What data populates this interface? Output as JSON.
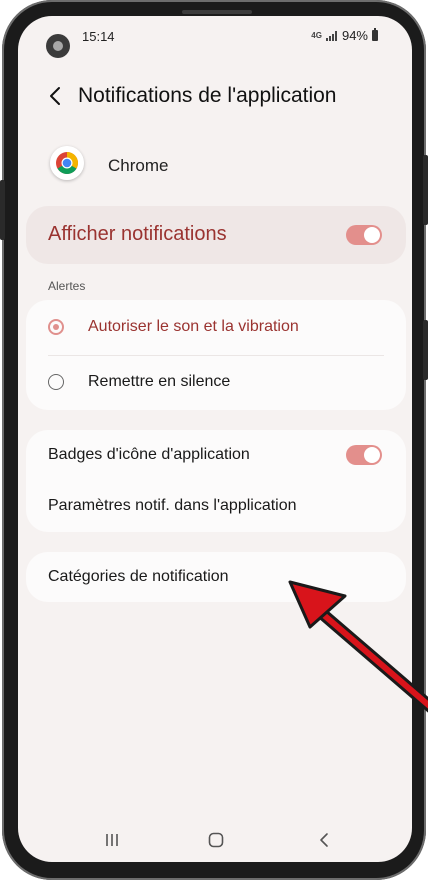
{
  "status_bar": {
    "time": "15:14",
    "network": "4G",
    "battery": "94%"
  },
  "header": {
    "title": "Notifications de l'application"
  },
  "app": {
    "name": "Chrome"
  },
  "main_toggle": {
    "label": "Afficher notifications"
  },
  "alerts": {
    "section_label": "Alertes",
    "options": [
      "Autoriser le son et la vibration",
      "Remettre en silence"
    ]
  },
  "badges": {
    "label": "Badges d'icône d'application",
    "settings_label": "Paramètres notif. dans l'application"
  },
  "categories": {
    "label": "Catégories de notification"
  },
  "colors": {
    "accent": "#9a3330",
    "toggle": "#e38f8c",
    "arrow": "#d8141b"
  }
}
